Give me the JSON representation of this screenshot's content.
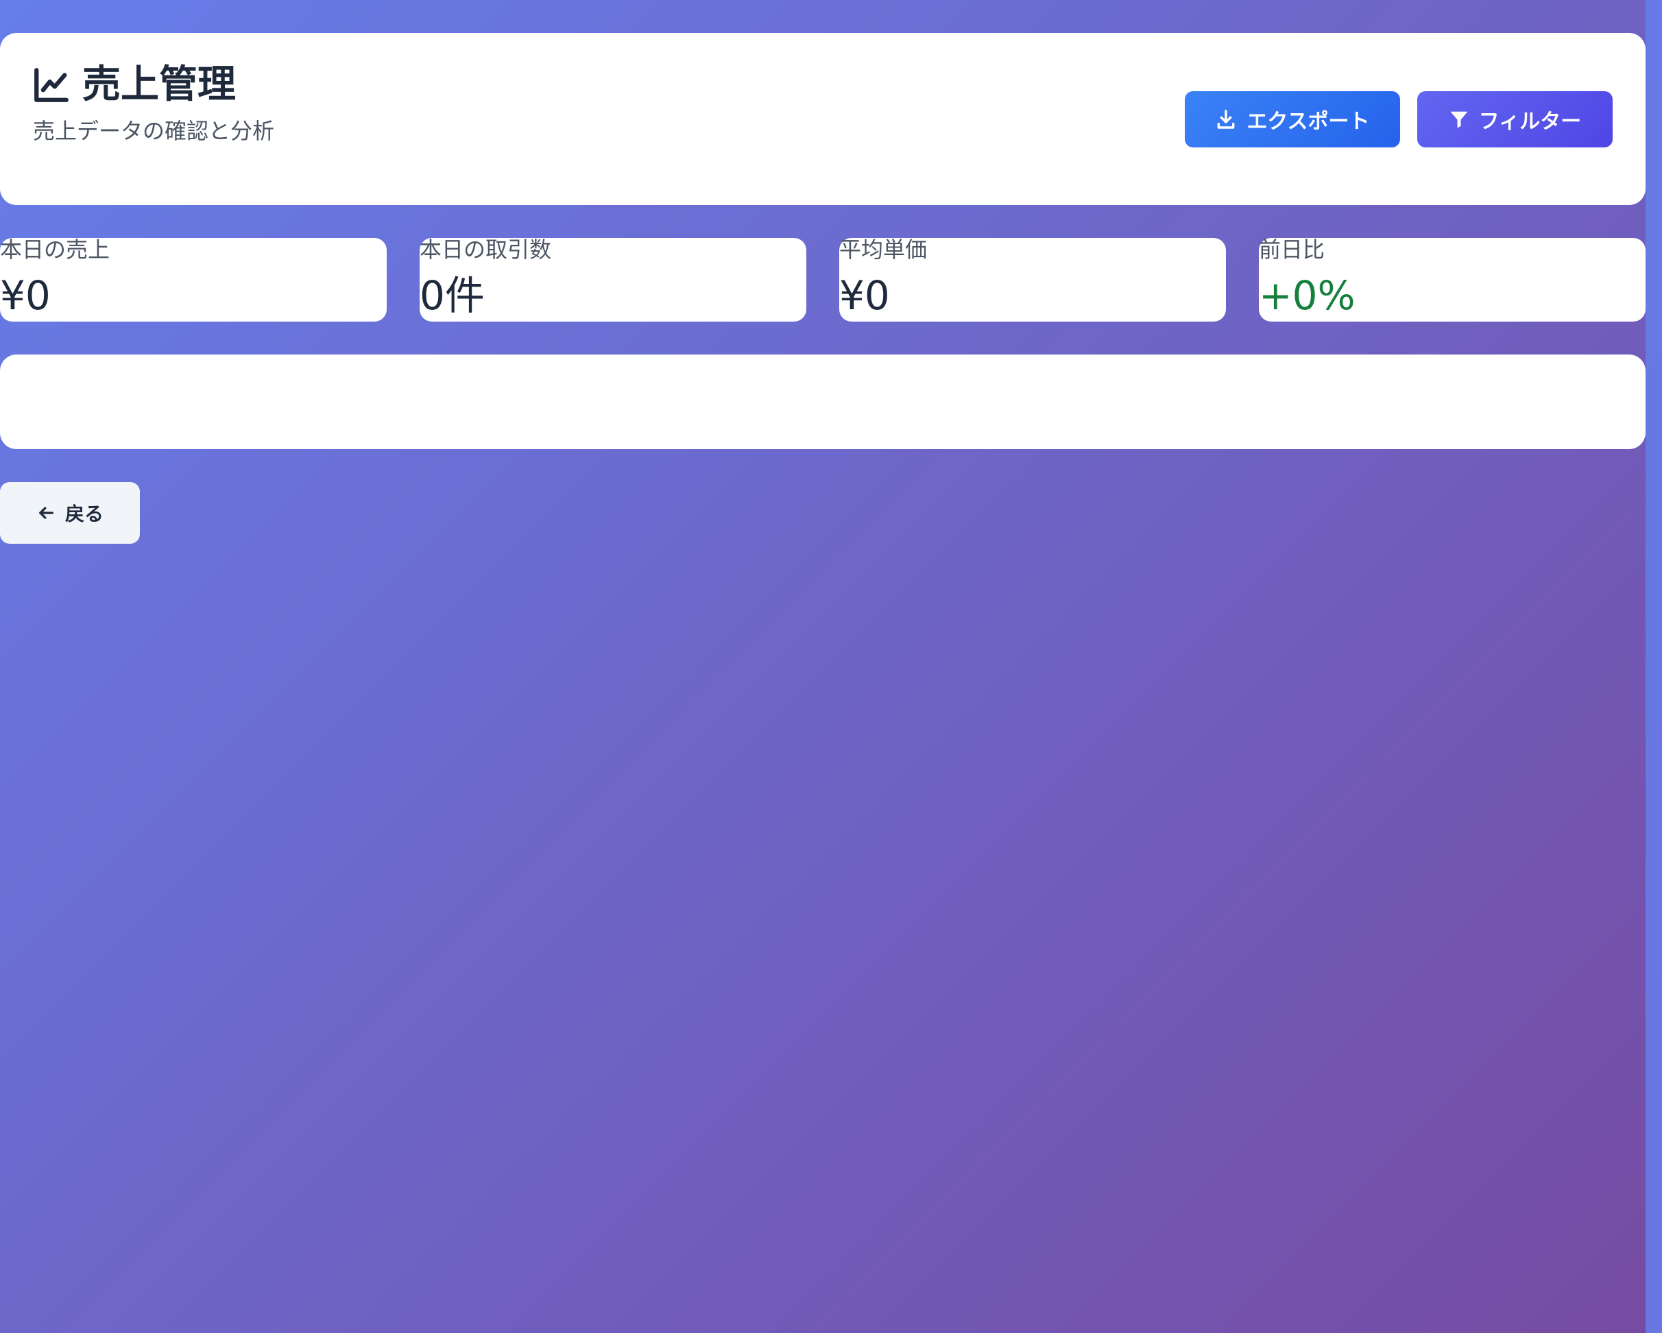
{
  "header": {
    "title": "売上管理",
    "subtitle": "売上データの確認と分析",
    "title_icon": "chart-line-icon"
  },
  "actions": {
    "export_label": "エクスポート",
    "export_icon": "download-icon",
    "filter_label": "フィルター",
    "filter_icon": "filter-icon"
  },
  "stats": [
    {
      "label": "本日の売上",
      "value": "¥0"
    },
    {
      "label": "本日の取引数",
      "value": "0件"
    },
    {
      "label": "平均単価",
      "value": "¥0"
    },
    {
      "label": "前日比",
      "value": "+0%"
    }
  ],
  "navigation": {
    "back_label": "戻る",
    "back_icon": "arrow-left-icon"
  },
  "colors": {
    "background_start": "#667eea",
    "background_end": "#764ba2",
    "export_button": "#3b82f6",
    "filter_button": "#6366f1",
    "positive_change": "#15803d",
    "text_primary": "#1e293b",
    "text_secondary": "#4b5563"
  }
}
